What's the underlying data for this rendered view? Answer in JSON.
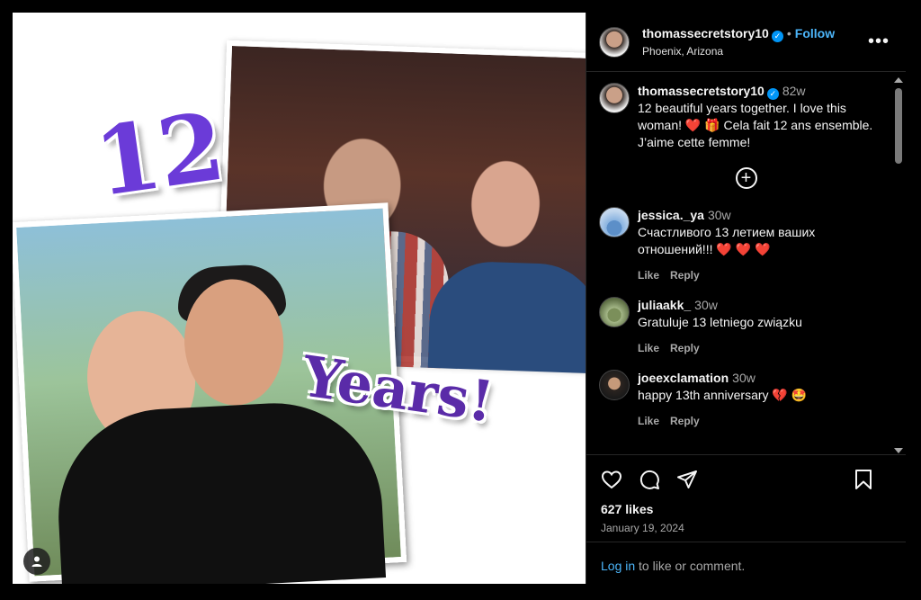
{
  "post": {
    "username": "thomassecretstory10",
    "location": "Phoenix, Arizona",
    "follow_label": "Follow",
    "separator": "•",
    "more_label": "•••",
    "caption_time": "82w",
    "caption_text": "12 beautiful years together. I love this woman! ❤️ 🎁 Cela fait 12 ans ensemble. J’aime cette femme!",
    "photo_text_top": "12",
    "photo_text_bottom": "Years!",
    "likes": "627 likes",
    "date": "January 19, 2024",
    "login_link": "Log in",
    "login_rest": " to like or comment."
  },
  "comments": [
    {
      "user": "jessica._ya",
      "time": "30w",
      "text": "Счастливого 13 летием ваших отношений!!! ❤️ ❤️ ❤️",
      "like": "Like",
      "reply": "Reply"
    },
    {
      "user": "juliaakk_",
      "time": "30w",
      "text": "Gratuluje 13 letniego związku",
      "like": "Like",
      "reply": "Reply"
    },
    {
      "user": "joeexclamation",
      "time": "30w",
      "text": "happy 13th anniversary 💔 🤩",
      "like": "Like",
      "reply": "Reply"
    }
  ],
  "icons": [
    "heart-icon",
    "comment-icon",
    "share-icon",
    "bookmark-icon",
    "plus-circle-icon",
    "user-tag-icon",
    "verified-icon",
    "more-icon"
  ],
  "colors": {
    "accent": "#4cb5f9",
    "verified": "#0095f6",
    "background": "#000000",
    "text_secondary": "#a8a8a8"
  }
}
